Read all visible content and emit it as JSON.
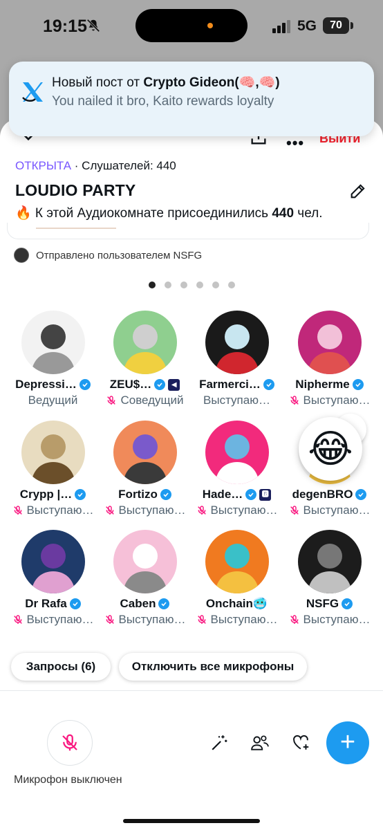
{
  "status_bar": {
    "time": "19:15",
    "network": "5G",
    "battery": "70"
  },
  "notification": {
    "prefix": "Новый пост от ",
    "author": "Crypto Gideon(🧠,🧠)",
    "body": "You nailed it bro, Kaito rewards loyalty"
  },
  "header": {
    "exit_label": "Выйти"
  },
  "space": {
    "state": "ОТКРЫТА",
    "listeners_text": " · Слушателей: 440",
    "title": "LOUDIO PARTY",
    "joined_prefix": "🔥 К этой Аудиокомнате присоединились ",
    "joined_count": "440",
    "joined_suffix": " чел.",
    "sent_by": "Отправлено пользователем NSFG"
  },
  "pager": {
    "count": 6,
    "active": 0
  },
  "speakers": [
    {
      "name": "Depressi…",
      "role": "Ведущий",
      "verified": true,
      "mic_off": false,
      "extra_badge": ""
    },
    {
      "name": "ZEU$…",
      "role": "Соведущий",
      "verified": true,
      "mic_off": true,
      "extra_badge": "◀"
    },
    {
      "name": "Farmerci…",
      "role": "Выступаю…",
      "verified": true,
      "mic_off": false,
      "extra_badge": ""
    },
    {
      "name": "Nipherme",
      "role": "Выступаю…",
      "verified": true,
      "mic_off": true,
      "extra_badge": ""
    },
    {
      "name": "Crypp |…",
      "role": "Выступаю…",
      "verified": true,
      "mic_off": true,
      "extra_badge": ""
    },
    {
      "name": "Fortizo",
      "role": "Выступаю…",
      "verified": true,
      "mic_off": true,
      "extra_badge": ""
    },
    {
      "name": "Hade…",
      "role": "Выступаю…",
      "verified": true,
      "mic_off": true,
      "extra_badge": "🅱"
    },
    {
      "name": "degenBRO",
      "role": "Выступаю…",
      "verified": true,
      "mic_off": true,
      "extra_badge": ""
    },
    {
      "name": "Dr Rafa",
      "role": "Выступаю…",
      "verified": true,
      "mic_off": true,
      "extra_badge": ""
    },
    {
      "name": "Caben",
      "role": "Выступаю…",
      "verified": true,
      "mic_off": true,
      "extra_badge": ""
    },
    {
      "name": "Onchain🥶",
      "role": "Выступаю…",
      "verified": false,
      "mic_off": true,
      "extra_badge": ""
    },
    {
      "name": "NSFG",
      "role": "Выступаю…",
      "verified": true,
      "mic_off": true,
      "extra_badge": ""
    }
  ],
  "reaction": {
    "emoji": "😂"
  },
  "actions": {
    "requests_label": "Запросы (6)",
    "mute_all_label": "Отключить все микрофоны"
  },
  "bottom": {
    "mic_label": "Микрофон выключен",
    "fab_label": "+"
  },
  "colors": {
    "accent": "#1d9bf0",
    "open_state": "#7856ff",
    "exit": "#f4212e",
    "mic_off": "#f91880"
  },
  "icons": [
    "chevron-down-icon",
    "share-icon",
    "more-icon",
    "edit-icon",
    "mic-off-icon",
    "sparkle-wand-icon",
    "people-icon",
    "heart-plus-icon",
    "plus-icon",
    "x-logo-icon",
    "bell-off-icon"
  ]
}
